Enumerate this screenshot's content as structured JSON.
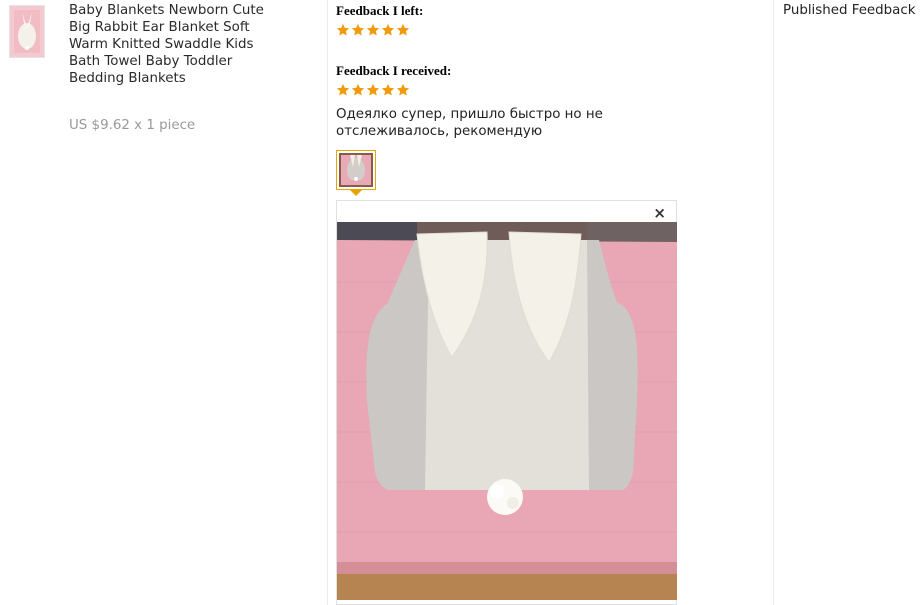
{
  "product": {
    "title": "Baby Blankets Newborn Cute Big Rabbit Ear Blanket Soft Warm Knitted Swaddle Kids Bath Towel Baby Toddler Bedding Blankets",
    "price": "US $9.62 x 1 piece"
  },
  "feedback": {
    "left_label": "Feedback I left:",
    "left_rating": 5,
    "received_label": "Feedback I received:",
    "received_rating": 5,
    "comment": "Одеялко супер, пришло быстро но не отслеживалось, рекомендую",
    "close_symbol": "×",
    "star_color": "#f19a0b",
    "thumb_border_color": "#e8a400"
  },
  "status": {
    "text": "Published Feedback"
  }
}
